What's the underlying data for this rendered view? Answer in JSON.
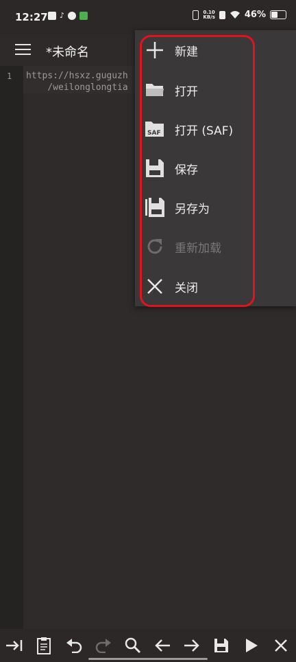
{
  "status": {
    "time": "12:27",
    "net_speed_value": "0.10",
    "net_speed_unit": "KB/s",
    "battery": "46%"
  },
  "app": {
    "title": "*未命名"
  },
  "editor": {
    "line_number": "1",
    "line_1a": "https://hsxz.guguzh",
    "line_1b": "    /weilonglongtia"
  },
  "menu": {
    "items": [
      {
        "label": "新建",
        "icon": "plus-icon",
        "enabled": true
      },
      {
        "label": "打开",
        "icon": "folder-open-icon",
        "enabled": true
      },
      {
        "label": "打开 (SAF)",
        "icon": "folder-saf-icon",
        "enabled": true
      },
      {
        "label": "保存",
        "icon": "save-icon",
        "enabled": true
      },
      {
        "label": "另存为",
        "icon": "save-as-icon",
        "enabled": true
      },
      {
        "label": "重新加载",
        "icon": "reload-icon",
        "enabled": false
      },
      {
        "label": "关闭",
        "icon": "close-icon",
        "enabled": true
      }
    ],
    "highlight_color": "#e2131c"
  },
  "toolbar": {
    "icons": [
      "indent-icon",
      "clipboard-icon",
      "undo-icon",
      "redo-icon",
      "search-icon",
      "arrow-left-icon",
      "arrow-right-icon",
      "save-icon",
      "play-icon",
      "close-icon"
    ],
    "saf_badge": "SAF"
  }
}
